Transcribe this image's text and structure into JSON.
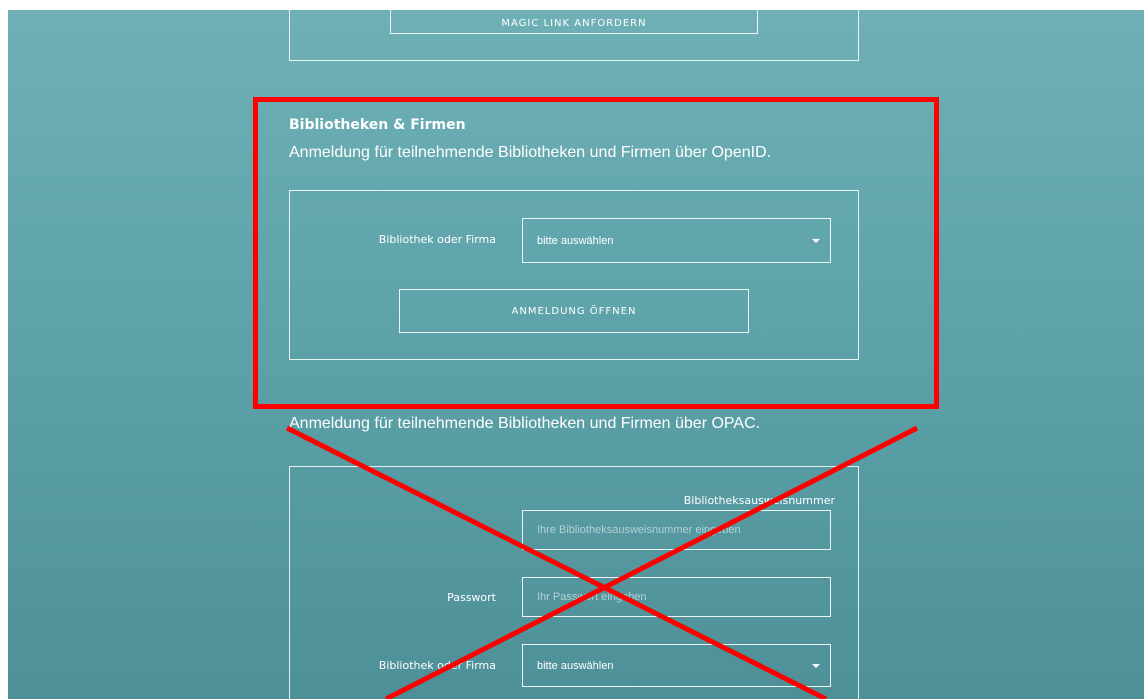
{
  "magic_link": {
    "button_label": "MAGIC LINK ANFORDERN"
  },
  "openid": {
    "heading": "Bibliotheken & Firmen",
    "description": "Anmeldung für teilnehmende Bibliotheken und Firmen über OpenID.",
    "select_label": "Bibliothek oder Firma",
    "select_value": "bitte auswählen",
    "button_label": "ANMELDUNG ÖFFNEN"
  },
  "opac": {
    "description": "Anmeldung für teilnehmende Bibliotheken und Firmen über OPAC.",
    "card_number_label": "Bibliotheksausweisnummer",
    "card_number_placeholder": "Ihre Bibliotheksausweisnummer eingeben",
    "password_label": "Passwort",
    "password_placeholder": "Ihr Passwort eingeben",
    "select_label": "Bibliothek oder Firma",
    "select_value": "bitte auswählen"
  },
  "annotations": {
    "highlight_color": "#ff0000",
    "cross_color": "#ff0000"
  },
  "icons": {
    "dropdown": "caret-down-icon"
  }
}
